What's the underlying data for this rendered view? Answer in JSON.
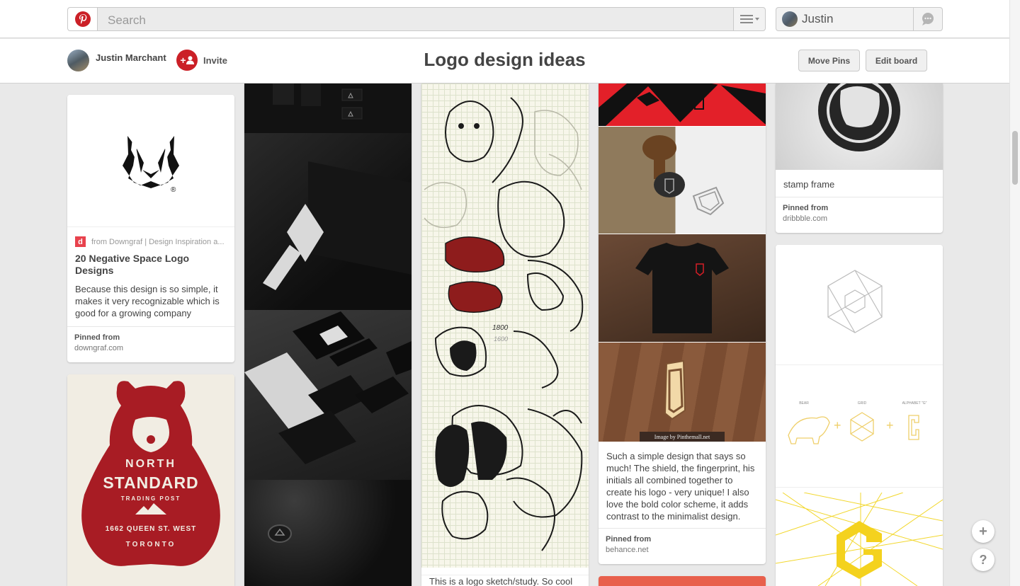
{
  "topbar": {
    "search_placeholder": "Search",
    "user_name": "Justin",
    "brand_color": "#cb2027"
  },
  "board": {
    "owner_name": "Justin Marchant",
    "invite_label": "Invite",
    "invite_icon_text": "+",
    "title": "Logo design ideas",
    "move_pins_label": "Move Pins",
    "edit_board_label": "Edit board"
  },
  "pins": {
    "fox": {
      "source_icon": "d",
      "source": "from Downgraf | Design Inspiration a...",
      "title": "20 Negative Space Logo Designs",
      "description": "Because this design is so simple, it makes it very recognizable which is good for a growing company",
      "pinned_label": "Pinned from",
      "pinned_from": "downgraf.com",
      "mark": "®"
    },
    "north_standard": {
      "line1": "NORTH",
      "line2": "STANDARD",
      "line3": "TRADING POST",
      "line4": "1662 QUEEN ST. WEST",
      "line5": "TORONTO"
    },
    "bear_sketch": {
      "description": "This is a logo sketch/study. So cool",
      "note1": "1800",
      "note2": "1600"
    },
    "shield": {
      "watermark": "Image by Pinthemall.net",
      "description": "Such a simple design that says so much! The shield, the fingerprint, his initials all combined together to create his logo - very unique! I also love the bold color scheme, it adds contrast to the minimalist design.",
      "pinned_label": "Pinned from",
      "pinned_from": "behance.net"
    },
    "stamp": {
      "description": "stamp frame",
      "pinned_label": "Pinned from",
      "pinned_from": "dribbble.com"
    },
    "alphabet": {
      "label1": "BEAR",
      "label2": "GRID",
      "label3": "ALPHABET \"G\""
    }
  },
  "floating": {
    "add_label": "+",
    "help_label": "?"
  }
}
